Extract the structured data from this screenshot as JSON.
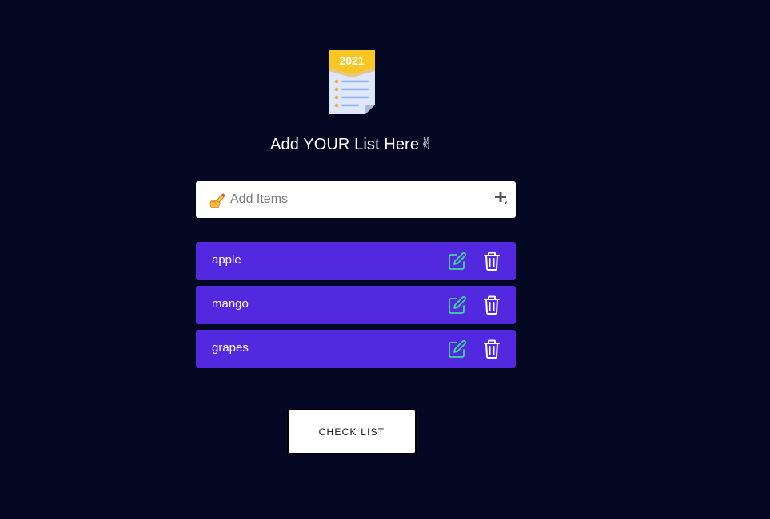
{
  "logo": {
    "year_text": "2021",
    "icon": "calendar-list-icon"
  },
  "heading": {
    "text": "Add YOUR List Here",
    "emoji": "✌"
  },
  "add_item": {
    "placeholder": "Add Items",
    "value": "",
    "pencil_icon": "writing-hand-icon",
    "add_icon": "plus-icon"
  },
  "items": [
    {
      "label": "apple"
    },
    {
      "label": "mango"
    },
    {
      "label": "grapes"
    }
  ],
  "item_actions": {
    "edit_icon": "edit-icon",
    "delete_icon": "trash-icon"
  },
  "check_button": {
    "label": "CHECK LIST"
  },
  "colors": {
    "background": "#050822",
    "item_background": "#5329df",
    "edit_icon": "#3ddc97",
    "logo_banner": "#f9c623",
    "logo_paper": "#dfe8fa"
  }
}
